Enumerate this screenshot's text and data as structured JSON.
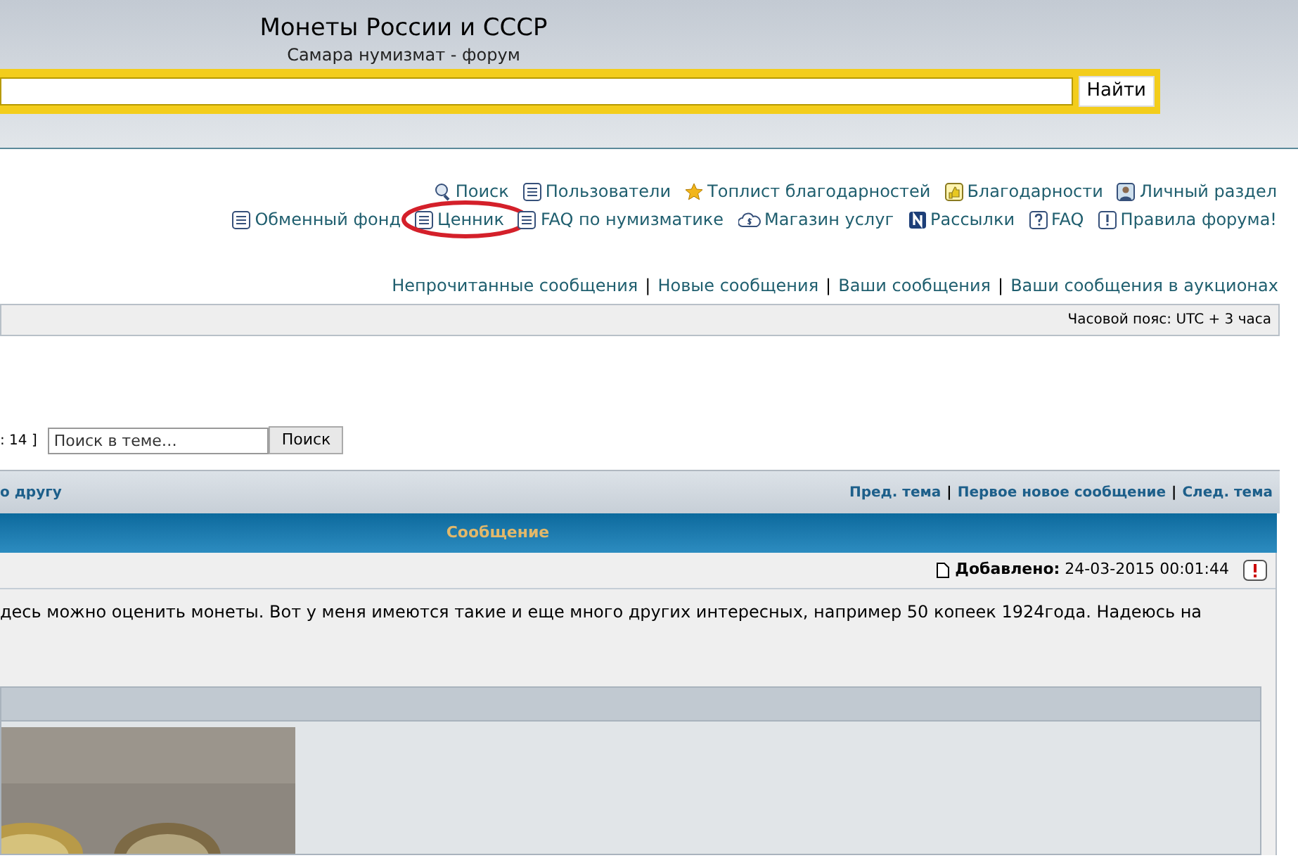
{
  "header": {
    "title": "Монеты России и СССР",
    "subtitle": "Самара нумизмат - форум",
    "search_button": "Найти"
  },
  "nav_rows": [
    [
      {
        "label": "Поиск",
        "highlighted": false
      },
      {
        "label": "Пользователи",
        "highlighted": false
      },
      {
        "label": "Топлист благодарностей",
        "highlighted": false
      },
      {
        "label": "Благодарности",
        "highlighted": false
      },
      {
        "label": "Личный раздел",
        "highlighted": false
      }
    ],
    [
      {
        "label": "Обменный фонд",
        "highlighted": false
      },
      {
        "label": "Ценник",
        "highlighted": true
      },
      {
        "label": "FAQ по нумизматике",
        "highlighted": false
      },
      {
        "label": "Магазин услуг",
        "highlighted": false
      },
      {
        "label": "Рассылки",
        "highlighted": false
      },
      {
        "label": "FAQ",
        "highlighted": false
      },
      {
        "label": "Правила форума!",
        "highlighted": false
      }
    ]
  ],
  "separator": "|",
  "message_links": [
    "Непрочитанные сообщения",
    "Новые сообщения",
    "Ваши сообщения",
    "Ваши сообщения в аукционах"
  ],
  "timezone": "Часовой пояс: UTC + 3 часа",
  "topic_search": {
    "pages": ": 14 ]",
    "placeholder": "Поиск в теме…",
    "button": "Поиск"
  },
  "topic_bar": {
    "left": "о другу",
    "links": [
      "Пред. тема",
      "Первое новое сообщение",
      "След. тема"
    ]
  },
  "post": {
    "header": "Сообщение",
    "added_label": "Добавлено:",
    "added_time": "24-03-2015 00:01:44",
    "text": "десь можно оценить монеты. Вот у меня имеются такие и еще много других интересных, например 50 копеек 1924года. Надеюсь на"
  }
}
